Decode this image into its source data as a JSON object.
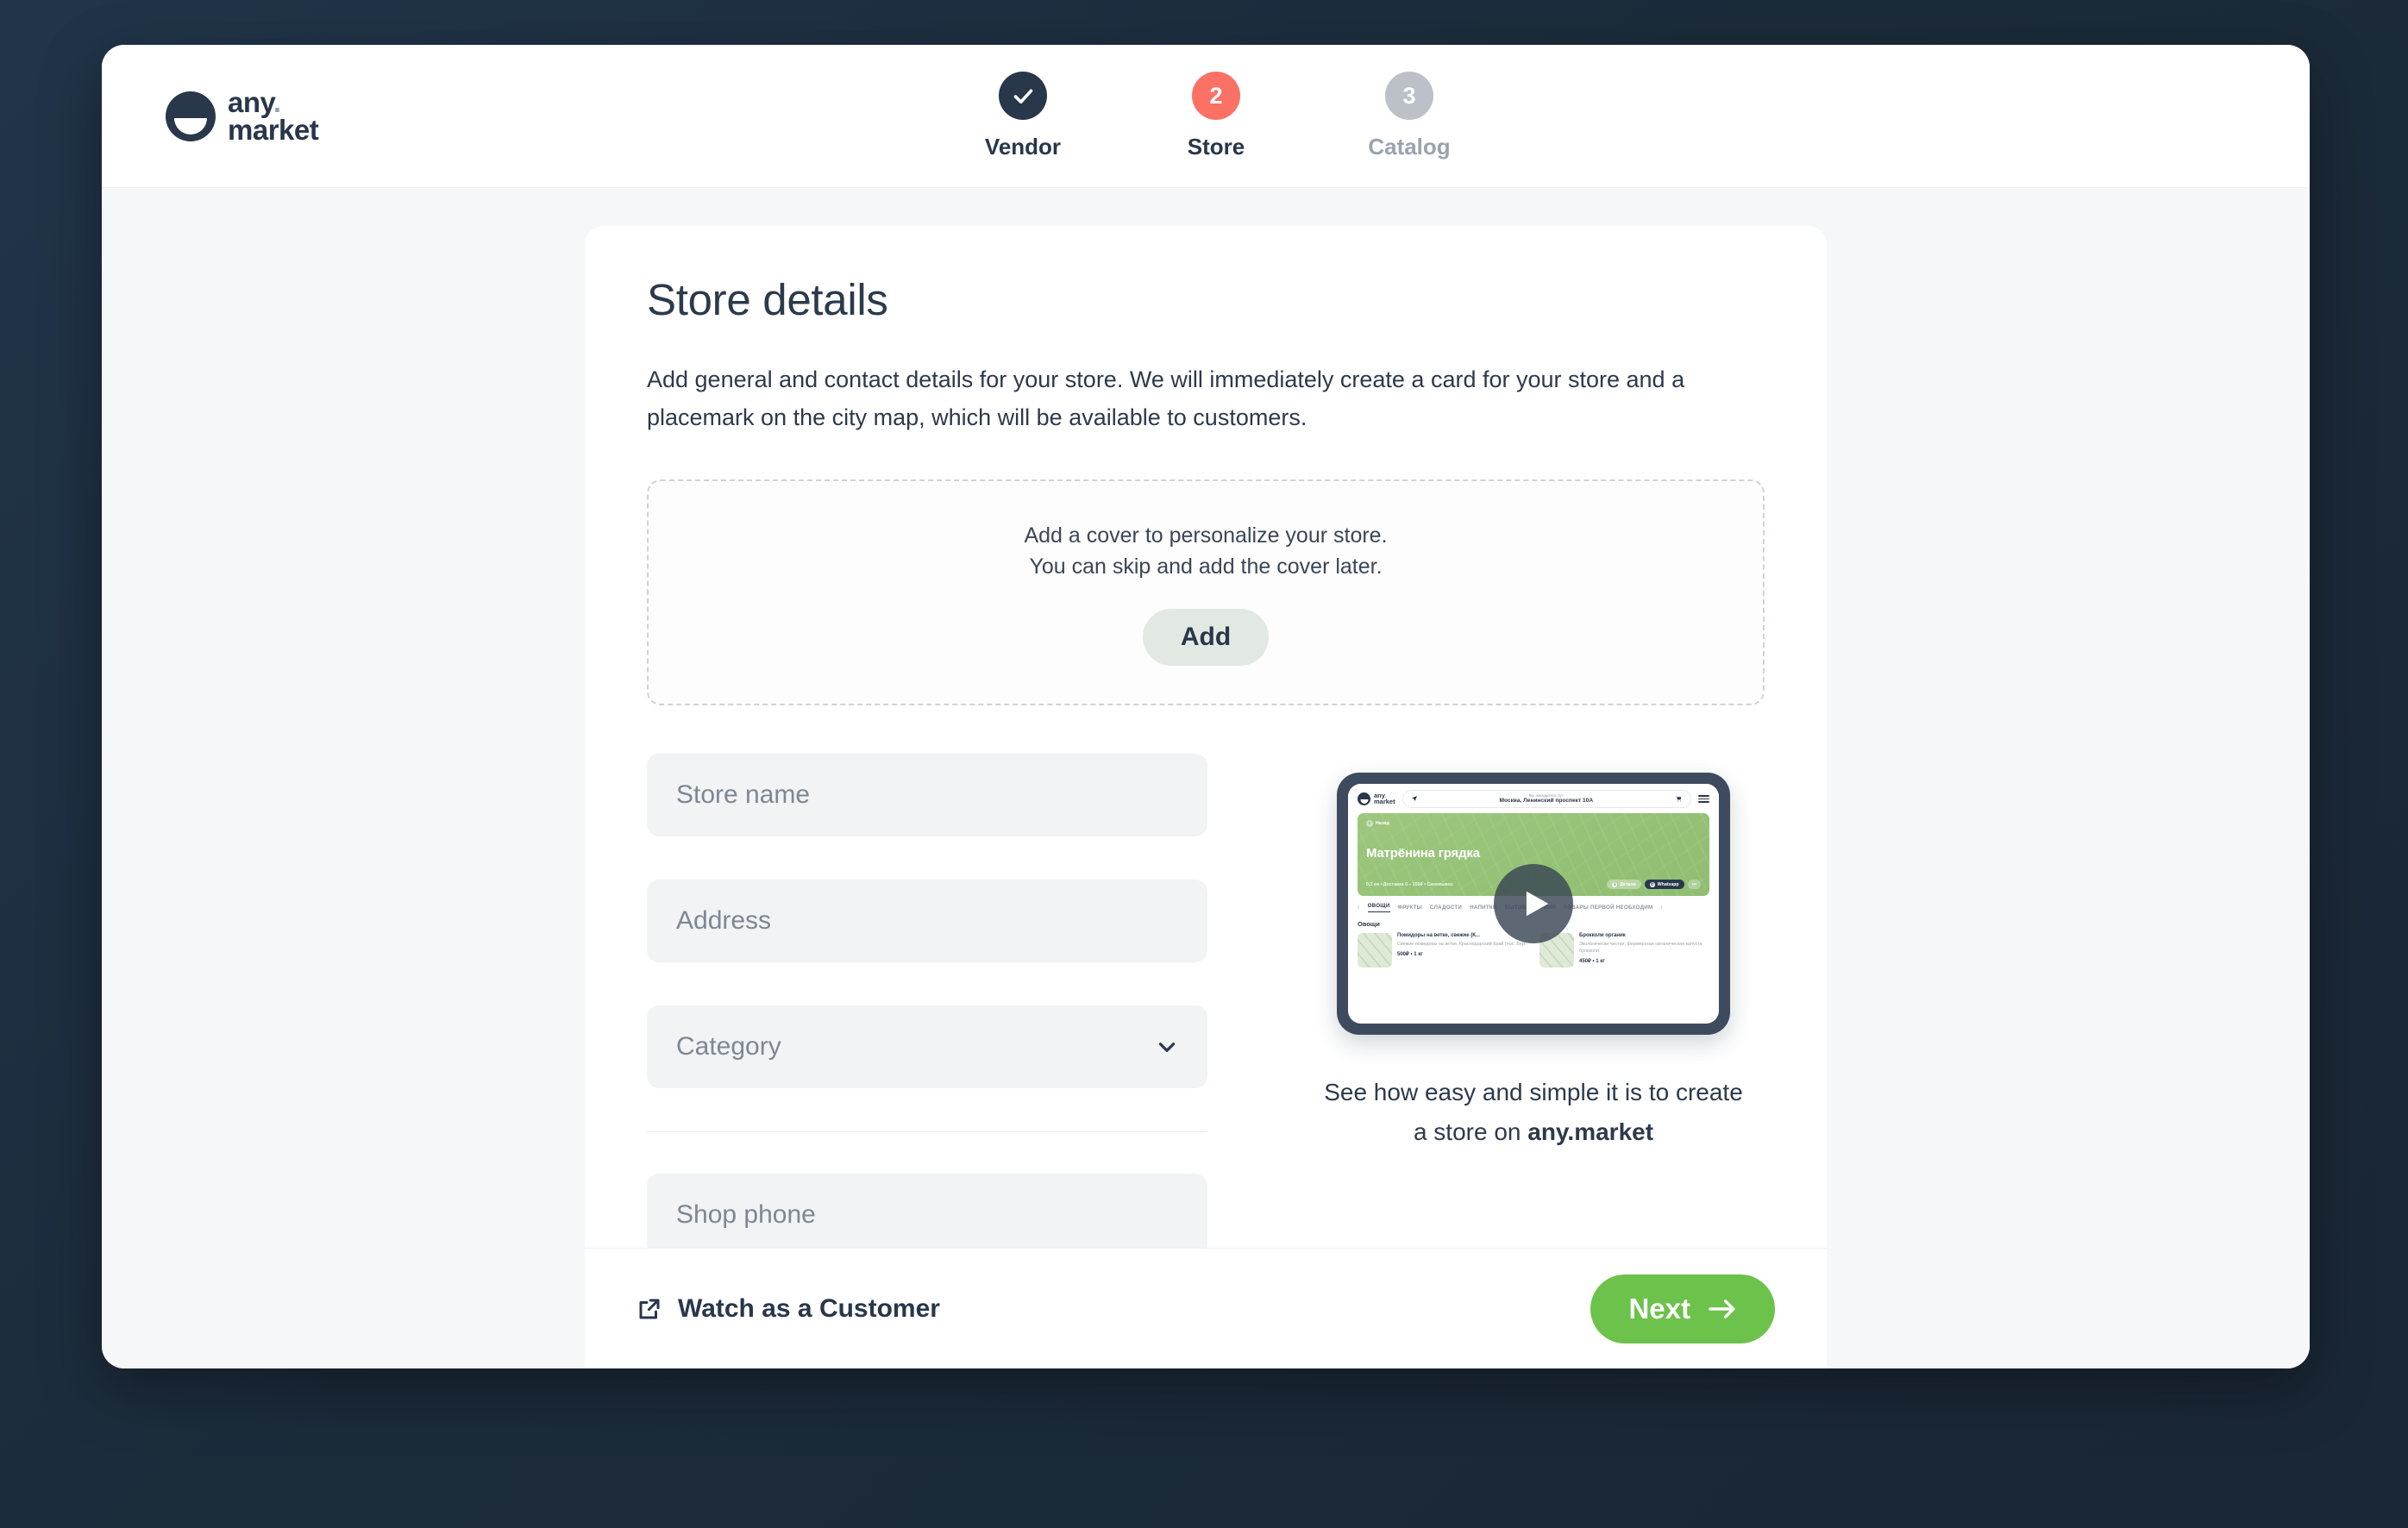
{
  "header": {
    "brand": {
      "line1": "any",
      "dot": ".",
      "line2": "market"
    },
    "steps": [
      {
        "label": "Vendor",
        "badge": "✓",
        "state": "done"
      },
      {
        "label": "Store",
        "badge": "2",
        "state": "active"
      },
      {
        "label": "Catalog",
        "badge": "3",
        "state": "idle"
      }
    ]
  },
  "main": {
    "title": "Store details",
    "description": "Add general and contact details for your store. We will immediately create a card for your store and a placemark on the city map, which will be available to customers.",
    "cover": {
      "line1": "Add a cover to personalize your store.",
      "line2": "You can skip and add the cover later.",
      "add_label": "Add"
    },
    "fields": [
      {
        "name": "store-name",
        "placeholder": "Store name",
        "value": ""
      },
      {
        "name": "address",
        "placeholder": "Address",
        "value": ""
      },
      {
        "name": "category",
        "placeholder": "Category",
        "value": ""
      },
      {
        "name": "shop-phone",
        "placeholder": "Shop phone",
        "value": ""
      }
    ],
    "promo": {
      "caption_plain_1": "See how easy and simple it is to create",
      "caption_plain_2": "a store on ",
      "caption_brand": "any.market",
      "video": {
        "mini_brand_1": "any",
        "mini_brand_dot": ".",
        "mini_brand_2": "market",
        "location_hint": "Вы находитесь тут",
        "location_value": "Москва, Ленинский проспект 10А",
        "back_label": "Назад",
        "store_name": "Матрёнина грядка",
        "store_meta": "0,3 км • Доставка 0 – 150₽ • Самовывоз",
        "chip_details": "Детали",
        "chip_whatsapp": "Whatsapp",
        "chip_more": "•••",
        "tabs": [
          "ОВОЩИ",
          "ФРУКТЫ",
          "СЛАДОСТИ",
          "НАПИТКИ",
          "БЫТОВАЯ ХИМИЯ",
          "ТОВАРЫ ПЕРВОЙ НЕОБХОДИМ"
        ],
        "section_title": "Овощи",
        "products": [
          {
            "title": "Помидоры на ветке, свежие (К...",
            "desc": "Свежие помидоры на ветке, Краснодарский Край (пос. Бер..",
            "price": "500₽ • 1 кг"
          },
          {
            "title": "Брокколи органик",
            "desc": "Экологически чистая, фермерская органическая капуста брокколи",
            "price": "450₽ • 1 кг"
          }
        ]
      }
    }
  },
  "footer": {
    "watch_label": "Watch as a Customer",
    "next_label": "Next"
  },
  "colors": {
    "page_background": "#1e2f40",
    "brand_navy": "#28374a",
    "step_active": "#fc7166",
    "step_idle": "#bcc1c8",
    "next_green": "#6cc24a",
    "field_bg": "#f1f3f5",
    "add_btn_bg": "#e2e9e2",
    "banner_green": "#9dc77e"
  }
}
